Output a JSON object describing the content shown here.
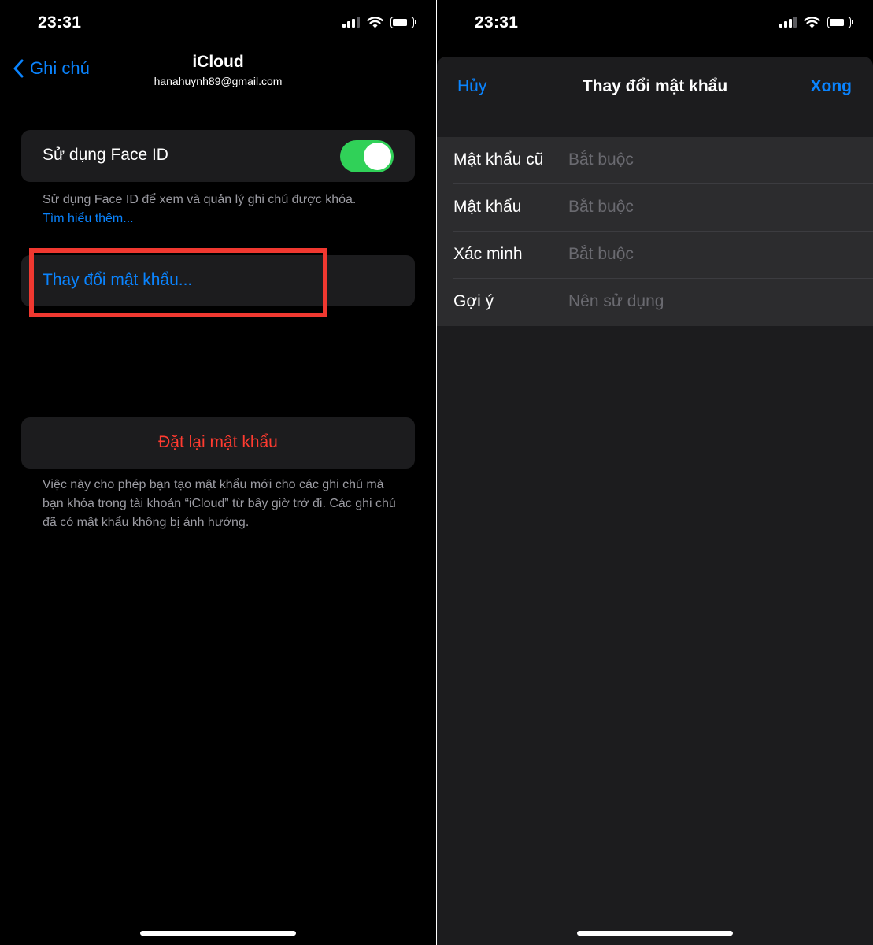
{
  "left": {
    "status": {
      "time": "23:31"
    },
    "nav": {
      "back_label": "Ghi chú",
      "title": "iCloud",
      "subtitle": "hanahuynh89@gmail.com"
    },
    "faceid": {
      "label": "Sử dụng Face ID",
      "toggle_on": true,
      "note": "Sử dụng Face ID để xem và quản lý ghi chú được khóa.",
      "link": "Tìm hiểu thêm..."
    },
    "change_password": {
      "label": "Thay đổi mật khẩu..."
    },
    "reset_password": {
      "label": "Đặt lại mật khẩu",
      "note": "Việc này cho phép bạn tạo mật khẩu mới cho các ghi chú mà bạn khóa trong tài khoản “iCloud” từ bây giờ trở đi. Các ghi chú đã có mật khẩu không bị ảnh hưởng."
    }
  },
  "right": {
    "status": {
      "time": "23:31"
    },
    "sheet": {
      "cancel": "Hủy",
      "title": "Thay đổi mật khẩu",
      "done": "Xong",
      "fields": [
        {
          "label": "Mật khẩu cũ",
          "placeholder": "Bắt buộc"
        },
        {
          "label": "Mật khẩu",
          "placeholder": "Bắt buộc"
        },
        {
          "label": "Xác minh",
          "placeholder": "Bắt buộc"
        },
        {
          "label": "Gợi ý",
          "placeholder": "Nên sử dụng"
        }
      ]
    }
  },
  "colors": {
    "accent": "#0a84ff",
    "destructive": "#ff3b30",
    "toggle_on": "#30d158",
    "highlight_box": "#f03830"
  },
  "icons": [
    "chevron-left-icon",
    "signal-icon",
    "wifi-icon",
    "battery-icon"
  ]
}
